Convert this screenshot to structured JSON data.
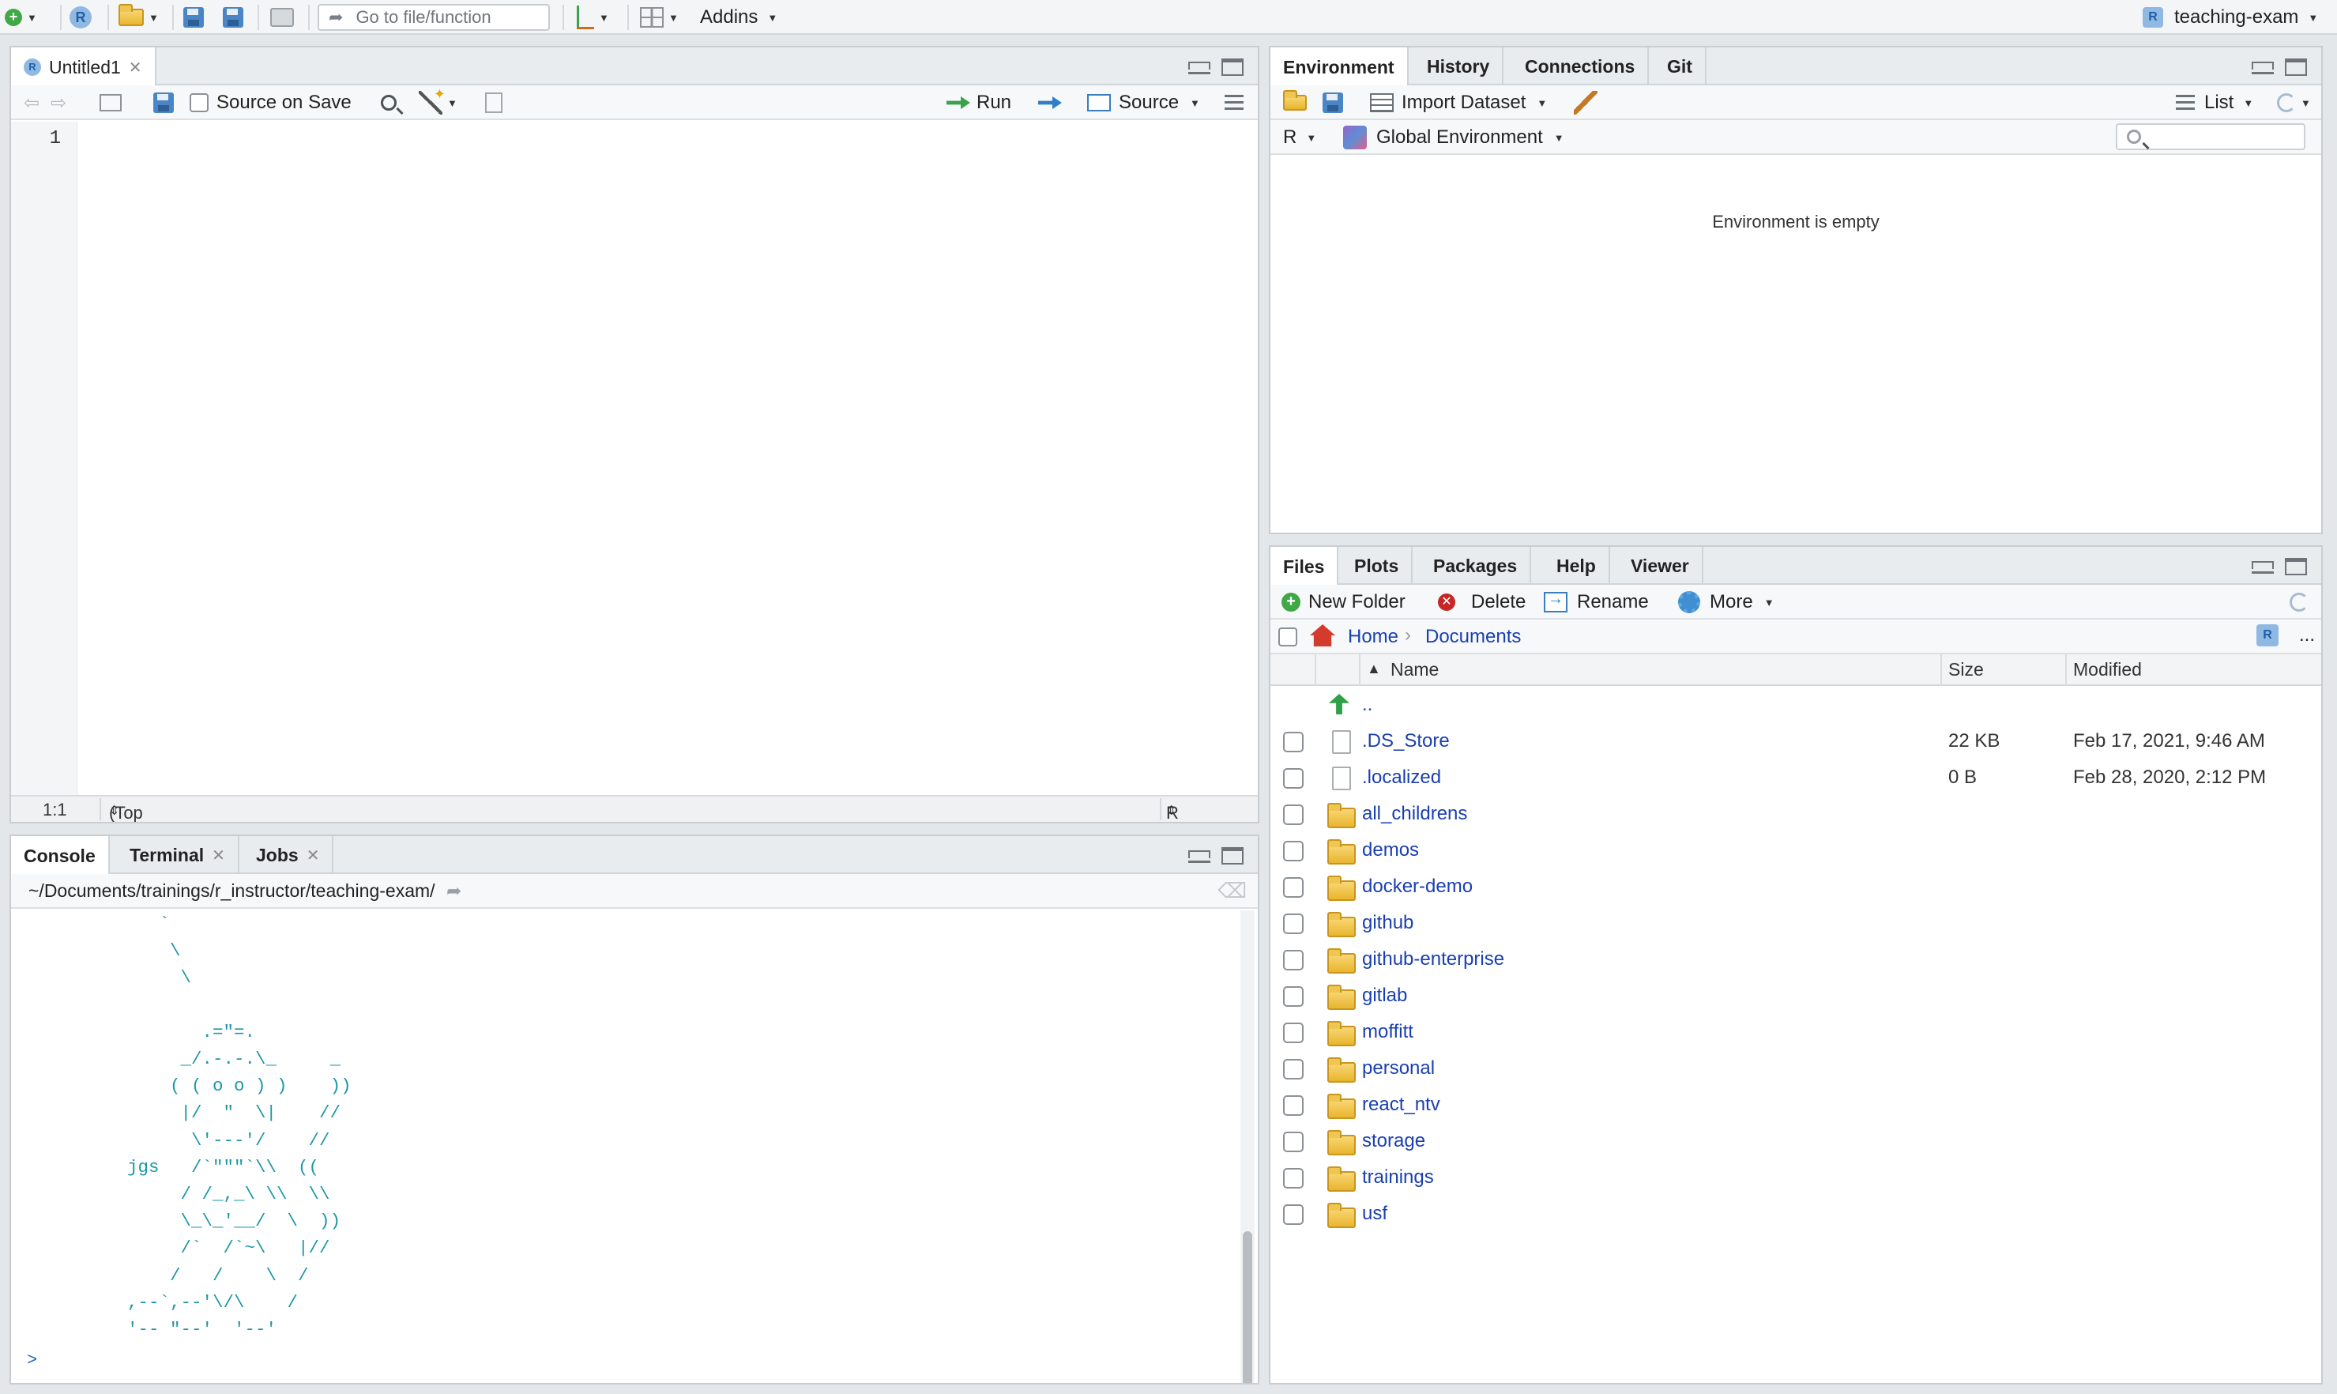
{
  "toolbar": {
    "goto_placeholder": "Go to file/function",
    "addins_label": "Addins",
    "project_label": "teaching-exam"
  },
  "source_pane": {
    "tab_label": "Untitled1",
    "source_on_save_label": "Source on Save",
    "run_label": "Run",
    "source_label": "Source",
    "line_number": "1",
    "cursor_position": "1:1",
    "scope": "(Top Level)",
    "file_type": "R Script"
  },
  "console_pane": {
    "tabs": [
      "Console",
      "Terminal",
      "Jobs"
    ],
    "path": "~/Documents/trainings/r_instructor/teaching-exam/",
    "ascii_art": "             `\n              \\\n               \\\n\n                 .=\"=.\n               _/.-.-.\\_     _\n              ( ( o o ) )    ))\n               |/  \"  \\|    //\n                \\'---'/    //\n          jgs   /`\"\"\"`\\\\  ((\n               / /_,_\\ \\\\  \\\\\n               \\_\\_'__/  \\  ))\n               /`  /`~\\   |//\n              /   /    \\  /\n          ,--`,--'\\/\\    /\n          '-- \"--'  '--'",
    "prompt": ">"
  },
  "environment_pane": {
    "tabs": [
      "Environment",
      "History",
      "Connections",
      "Git"
    ],
    "import_dataset_label": "Import Dataset",
    "list_label": "List",
    "language_label": "R",
    "scope_label": "Global Environment",
    "empty_message": "Environment is empty"
  },
  "files_pane": {
    "tabs": [
      "Files",
      "Plots",
      "Packages",
      "Help",
      "Viewer"
    ],
    "new_folder_label": "New Folder",
    "delete_label": "Delete",
    "rename_label": "Rename",
    "more_label": "More",
    "breadcrumb": [
      "Home",
      "Documents"
    ],
    "more_dots": "...",
    "columns": {
      "name": "Name",
      "size": "Size",
      "modified": "Modified"
    },
    "parent_label": "..",
    "files": [
      {
        "name": ".DS_Store",
        "type": "file",
        "size": "22 KB",
        "modified": "Feb 17, 2021, 9:46 AM"
      },
      {
        "name": ".localized",
        "type": "file",
        "size": "0 B",
        "modified": "Feb 28, 2020, 2:12 PM"
      },
      {
        "name": "all_childrens",
        "type": "folder",
        "size": "",
        "modified": ""
      },
      {
        "name": "demos",
        "type": "folder",
        "size": "",
        "modified": ""
      },
      {
        "name": "docker-demo",
        "type": "folder",
        "size": "",
        "modified": ""
      },
      {
        "name": "github",
        "type": "folder",
        "size": "",
        "modified": ""
      },
      {
        "name": "github-enterprise",
        "type": "folder",
        "size": "",
        "modified": ""
      },
      {
        "name": "gitlab",
        "type": "folder",
        "size": "",
        "modified": ""
      },
      {
        "name": "moffitt",
        "type": "folder",
        "size": "",
        "modified": ""
      },
      {
        "name": "personal",
        "type": "folder",
        "size": "",
        "modified": ""
      },
      {
        "name": "react_ntv",
        "type": "folder",
        "size": "",
        "modified": ""
      },
      {
        "name": "storage",
        "type": "folder",
        "size": "",
        "modified": ""
      },
      {
        "name": "trainings",
        "type": "folder",
        "size": "",
        "modified": ""
      },
      {
        "name": "usf",
        "type": "folder",
        "size": "",
        "modified": ""
      }
    ]
  }
}
